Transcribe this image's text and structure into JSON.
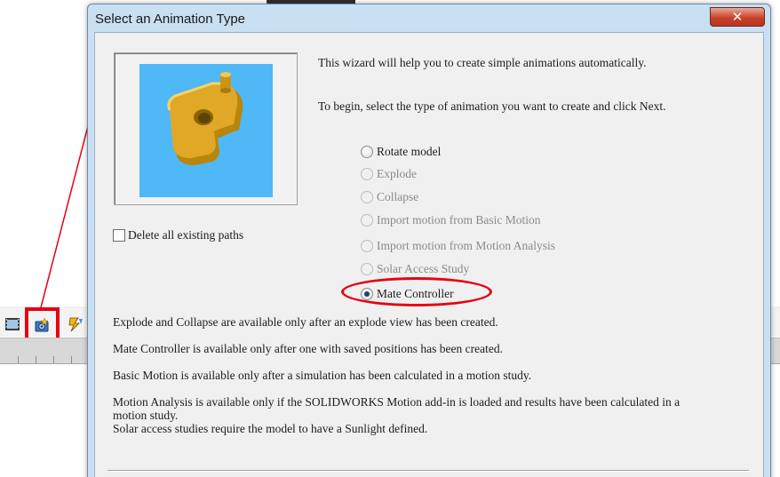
{
  "dialog": {
    "title": "Select an Animation Type",
    "close_label": "✕",
    "intro_line1": "This wizard will help you to create simple animations automatically.",
    "intro_line2": "To begin, select the type of animation you want to create and click Next.",
    "delete_paths_label": "Delete all existing paths",
    "delete_paths_checked": false,
    "options": [
      {
        "label": "Rotate model",
        "enabled": true,
        "checked": false
      },
      {
        "label": "Explode",
        "enabled": false,
        "checked": false
      },
      {
        "label": "Collapse",
        "enabled": false,
        "checked": false
      },
      {
        "label": "Import motion from Basic Motion",
        "enabled": false,
        "checked": false
      },
      {
        "label": "Import motion from Motion Analysis",
        "enabled": false,
        "checked": false
      },
      {
        "label": "Solar Access Study",
        "enabled": false,
        "checked": false
      },
      {
        "label": "Mate Controller",
        "enabled": true,
        "checked": true
      }
    ],
    "notes": [
      "Explode and Collapse are available only after an explode view has been created.",
      "Mate Controller is available only after one with saved positions has been created.",
      "Basic Motion is available only after a simulation has been calculated in a motion study.",
      "Motion Analysis is available only if the SOLIDWORKS Motion add-in is loaded and results have been calculated in a",
      "motion study.",
      "Solar access studies require the model to have a Sunlight defined."
    ]
  },
  "toolbar": {
    "icons": [
      "film-icon",
      "animation-wizard-icon",
      "motion-bolt-icon"
    ]
  },
  "colors": {
    "highlight": "#e60012",
    "preview_background": "#4fb8f6",
    "part_gold": "#e0a826"
  }
}
